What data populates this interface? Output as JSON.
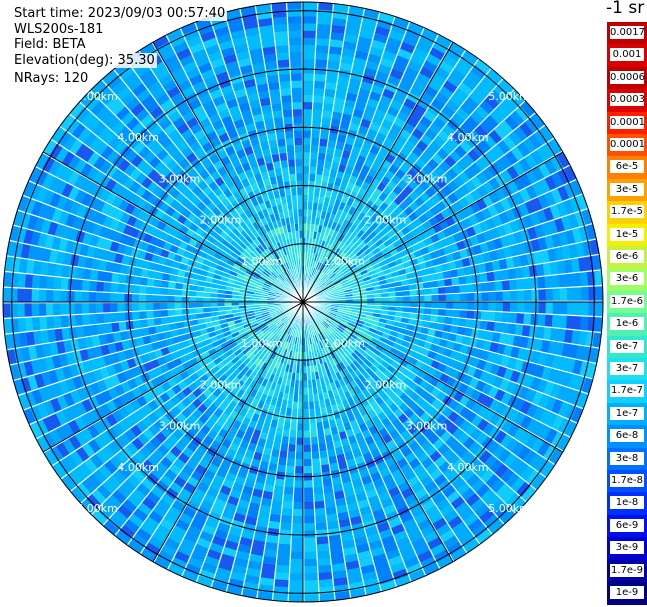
{
  "info": {
    "start_time": "Start time: 2023/09/03 00:57:40",
    "instrument": "WLS200s-181",
    "field": "Field: BETA",
    "elevation": "Elevation(deg): 35.30",
    "nrays": "NRays: 120"
  },
  "colorbar": {
    "title": "-1 sr",
    "levels": [
      {
        "label": "0.0017",
        "color": "#c00000"
      },
      {
        "label": "0.001",
        "color": "#d80000"
      },
      {
        "label": "0.0006",
        "color": "#c00000"
      },
      {
        "label": "0.0003",
        "color": "#e00000"
      },
      {
        "label": "0.00017",
        "color": "#ff2000"
      },
      {
        "label": "0.0001",
        "color": "#ff5000"
      },
      {
        "label": "6e-5",
        "color": "#ff8000"
      },
      {
        "label": "3e-5",
        "color": "#ffa000"
      },
      {
        "label": "1.7e-5",
        "color": "#ffd000"
      },
      {
        "label": "1e-5",
        "color": "#f0f000"
      },
      {
        "label": "6e-6",
        "color": "#c8f040"
      },
      {
        "label": "3e-6",
        "color": "#a0ff60"
      },
      {
        "label": "1.7e-6",
        "color": "#70ff90"
      },
      {
        "label": "1e-6",
        "color": "#50f0b0"
      },
      {
        "label": "6e-7",
        "color": "#30e8d0"
      },
      {
        "label": "3e-7",
        "color": "#20e0f0"
      },
      {
        "label": "1.7e-7",
        "color": "#10d0ff"
      },
      {
        "label": "1e-7",
        "color": "#00b0ff"
      },
      {
        "label": "6e-8",
        "color": "#0090ff"
      },
      {
        "label": "3e-8",
        "color": "#0070ff"
      },
      {
        "label": "1.7e-8",
        "color": "#0050ff"
      },
      {
        "label": "1e-8",
        "color": "#0030ff"
      },
      {
        "label": "6e-9",
        "color": "#0010f0"
      },
      {
        "label": "3e-9",
        "color": "#0000d0"
      },
      {
        "label": "1.7e-9",
        "color": "#0000a0"
      },
      {
        "label": "1e-9",
        "color": "#000080"
      }
    ]
  },
  "chart_data": {
    "type": "heatmap",
    "title": "",
    "field": "BETA",
    "nrays": 120,
    "range_rings": [
      {
        "value": 1.0,
        "label": "1.00km"
      },
      {
        "value": 2.0,
        "label": "2.00km"
      },
      {
        "value": 3.0,
        "label": "3.00km"
      },
      {
        "value": 4.0,
        "label": "4.00km"
      },
      {
        "value": 5.0,
        "label": "5.00km"
      }
    ],
    "max_range_km": 5.15,
    "spoke_angles_deg": [
      0,
      30,
      60,
      90,
      120,
      150,
      180,
      210,
      240,
      270,
      300,
      330
    ],
    "dominant_values": [
      "3e-8",
      "1e-7",
      "1.7e-7",
      "3e-7"
    ],
    "colors": {
      "background": "#00b4ff",
      "ring_line": "#000000",
      "gap_line": "#ffffff",
      "label_text": "#ffffff"
    }
  }
}
